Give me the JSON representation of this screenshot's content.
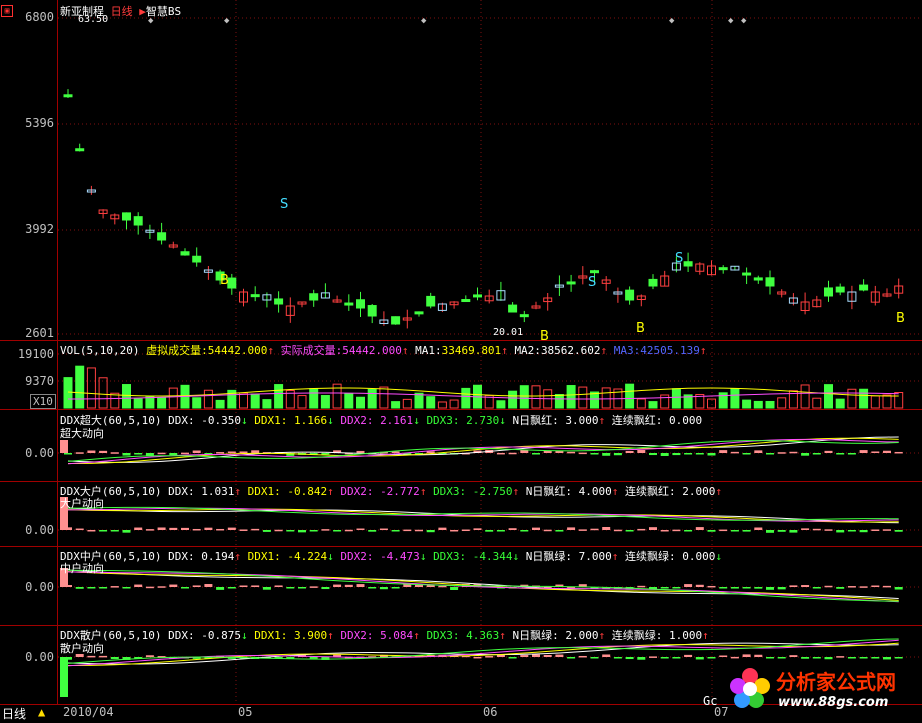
{
  "main": {
    "corner_icon": "red-square-icon",
    "stock_name": "新亚制程",
    "period": "日线",
    "indicator": "智慧BS",
    "top_label": "63.50",
    "price_levels": [
      "6800",
      "5396",
      "3992",
      "2601"
    ],
    "low_label": "20.01",
    "signals": {
      "buy": "B",
      "sell": "S"
    }
  },
  "vol": {
    "params": "VOL(5,10,20)",
    "virtual_label": "虚拟成交量:",
    "virtual_value": "54442.000",
    "actual_label": "实际成交量:",
    "actual_value": "54442.000",
    "ma1_label": "MA1:",
    "ma1_value": "33469.801",
    "ma2_label": "MA2:",
    "ma2_value": "38562.602",
    "ma3_label": "MA3:",
    "ma3_value": "42505.139",
    "levels": [
      "19100",
      "9370"
    ],
    "unit": "X10"
  },
  "panels": [
    {
      "title": "DDX超大(60,5,10)",
      "ddx": "DDX: -0.350",
      "ddx1": "DDX1: 1.166",
      "ddx2": "DDX2: 2.161",
      "ddx3": "DDX3: 2.730",
      "n_label": "N日飘红: 3.000",
      "cont_label": "连续飘红: 0.000",
      "sub": "超大动向",
      "zero": "0.00"
    },
    {
      "title": "DDX大户(60,5,10)",
      "ddx": "DDX: 1.031",
      "ddx1": "DDX1: -0.842",
      "ddx2": "DDX2: -2.772",
      "ddx3": "DDX3: -2.750",
      "n_label": "N日飘红: 4.000",
      "cont_label": "连续飘红: 2.000",
      "sub": "大户动向",
      "zero": "0.00"
    },
    {
      "title": "DDX中户(60,5,10)",
      "ddx": "DDX: 0.194",
      "ddx1": "DDX1: -4.224",
      "ddx2": "DDX2: -4.473",
      "ddx3": "DDX3: -4.344",
      "n_label": "N日飘绿: 7.000",
      "cont_label": "连续飘绿: 0.000",
      "sub": "中户动向",
      "zero": "0.00"
    },
    {
      "title": "DDX散户(60,5,10)",
      "ddx": "DDX: -0.875",
      "ddx1": "DDX1: 3.900",
      "ddx2": "DDX2: 5.084",
      "ddx3": "DDX3: 4.363",
      "n_label": "N日飘绿: 2.000",
      "cont_label": "连续飘绿: 1.000",
      "sub": "散户动向",
      "zero": "0.00"
    }
  ],
  "bottom": {
    "period_button": "日线",
    "triangle_icon": "up-triangle-icon",
    "dates": [
      "2010/04",
      "05",
      "06",
      "07"
    ],
    "cursor_text": "Gc"
  },
  "watermark": {
    "name": "分析家公式网",
    "url": "www.88gs.com"
  }
}
